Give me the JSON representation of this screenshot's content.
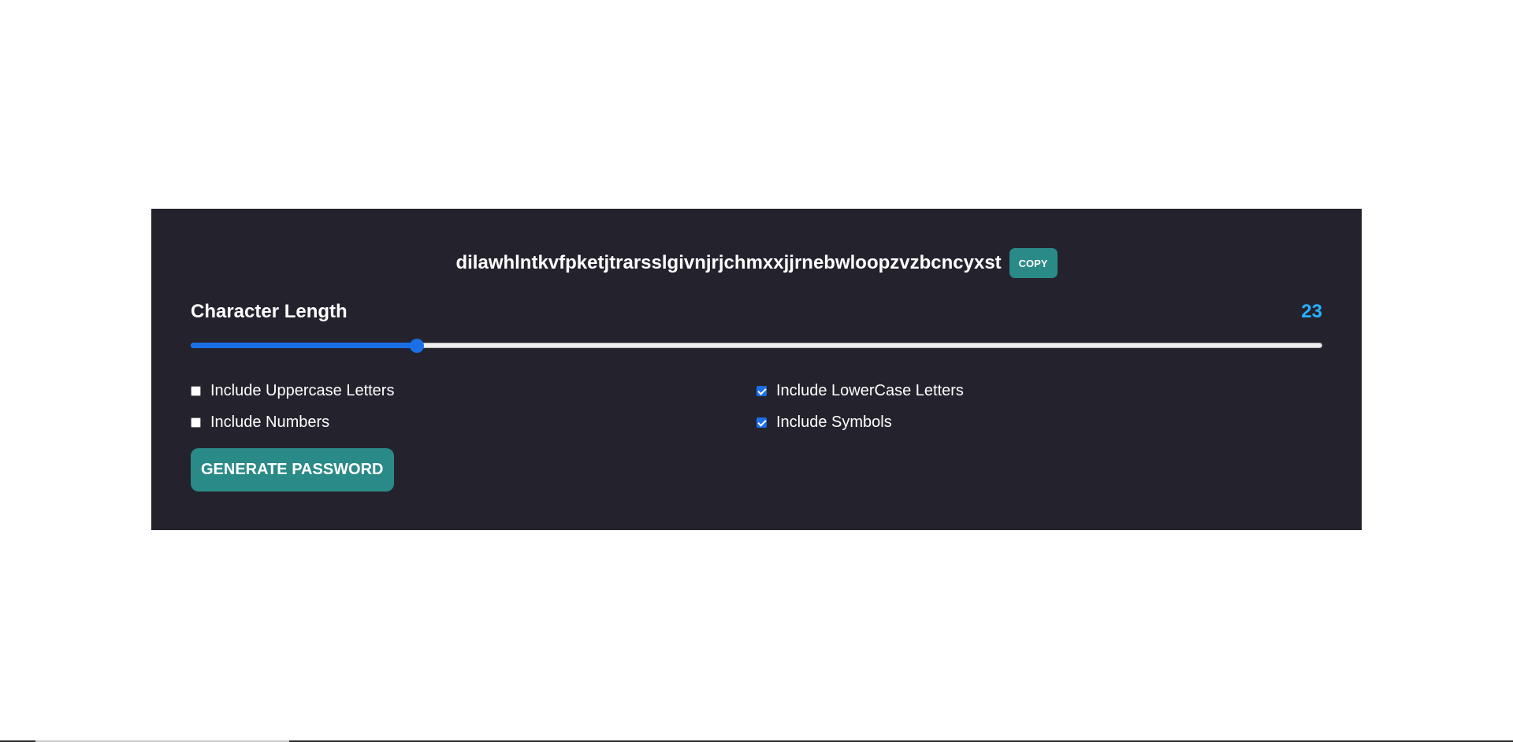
{
  "password": {
    "value": "dilawhlntkvfpketjtrarsslgivnjrjchmxxjjrnebwloopzvzbcncyxst",
    "copy_label": "COPY"
  },
  "length": {
    "label": "Character Length",
    "value": "23",
    "slider_fraction": 0.2
  },
  "options": [
    {
      "label": "Include Uppercase Letters",
      "checked": false
    },
    {
      "label": "Include LowerCase Letters",
      "checked": true
    },
    {
      "label": "Include Numbers",
      "checked": false
    },
    {
      "label": "Include Symbols",
      "checked": true
    }
  ],
  "generate_label": "GENERATE PASSWORD",
  "colors": {
    "card_bg": "#24232d",
    "accent_teal": "#2a8a87",
    "length_value": "#27b1ff",
    "slider_blue": "#1a6fe6"
  }
}
